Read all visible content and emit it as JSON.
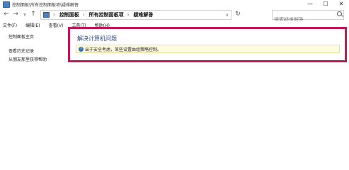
{
  "window": {
    "title": "控制面板\\所有控制面板项\\疑难解答",
    "controls": {
      "minimize": "—",
      "maximize": "☐",
      "close": "✕"
    }
  },
  "nav": {
    "back": "←",
    "forward": "→",
    "recent": "∨",
    "up": "↑",
    "breadcrumbs": [
      "控制面板",
      "所有控制面板项",
      "疑难解答"
    ],
    "separator": "›",
    "refresh": "↻",
    "search_placeholder": "搜索疑难解答"
  },
  "menu": [
    "文件(F)",
    "编辑(E)",
    "查看(V)",
    "工具(T)",
    "帮助(H)"
  ],
  "sidebar": {
    "items": [
      "控制面板主页",
      "查看历史记录",
      "从朋友那里获得帮助"
    ]
  },
  "main": {
    "heading": "解决计算机问题",
    "info": "出于安全考虑，某些设置由组策略控制。"
  }
}
